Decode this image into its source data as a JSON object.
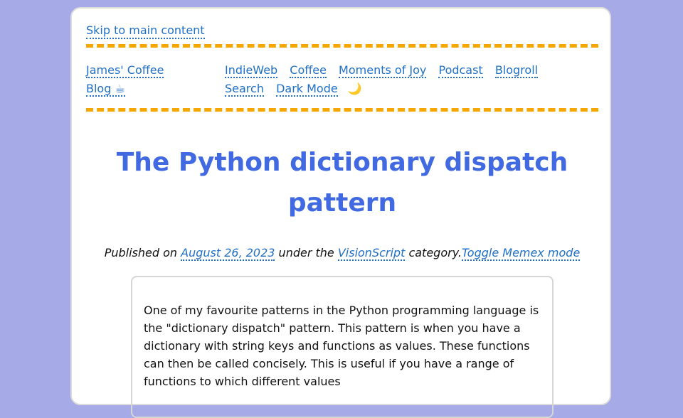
{
  "skip_link": "Skip to main content",
  "brand": {
    "line1": "James' Coffee",
    "line2": "Blog ☕"
  },
  "nav": {
    "items": [
      "IndieWeb",
      "Coffee",
      "Moments of Joy",
      "Podcast",
      "Blogroll",
      "Search",
      "Dark Mode"
    ],
    "moon_icon": "🌙"
  },
  "article": {
    "title": "The Python dictionary dispatch pattern",
    "meta": {
      "published_prefix": "Published on ",
      "date": "August 26, 2023",
      "under": " under the ",
      "category": "VisionScript",
      "category_suffix": " category.",
      "memex_toggle": "Toggle Memex mode"
    },
    "body": "One of my favourite patterns in the Python programming language is the \"dictionary dispatch\" pattern. This pattern is when you have a dictionary with string keys and functions as values. These functions can then be called concisely. This is useful if you have a range of functions to which different values"
  },
  "colors": {
    "background": "#a6aae6",
    "link": "#1f6fc5",
    "title": "#4169e1",
    "rule": "#f5a700"
  }
}
